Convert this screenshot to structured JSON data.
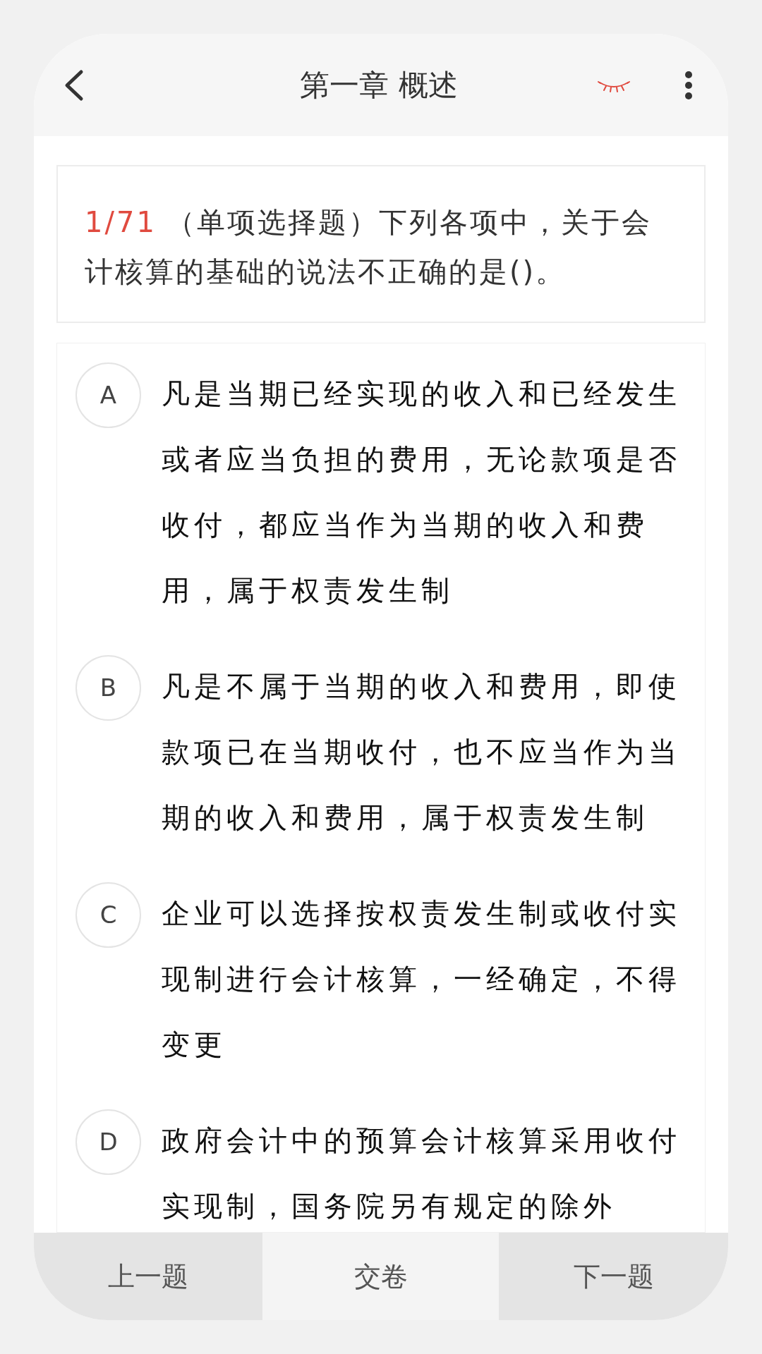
{
  "header": {
    "title": "第一章 概述"
  },
  "question": {
    "number": "1/71",
    "text": "（单项选择题）下列各项中，关于会计核算的基础的说法不正确的是()。"
  },
  "options": [
    {
      "letter": "A",
      "text": "凡是当期已经实现的收入和已经发生或者应当负担的费用，无论款项是否收付，都应当作为当期的收入和费用，属于权责发生制"
    },
    {
      "letter": "B",
      "text": "凡是不属于当期的收入和费用，即使款项已在当期收付，也不应当作为当期的收入和费用，属于权责发生制"
    },
    {
      "letter": "C",
      "text": "企业可以选择按权责发生制或收付实现制进行会计核算，一经确定，不得变更"
    },
    {
      "letter": "D",
      "text": "政府会计中的预算会计核算采用收付实现制，国务院另有规定的除外"
    }
  ],
  "bottom_bar": {
    "previous": "上一题",
    "submit": "交卷",
    "next": "下一题"
  }
}
